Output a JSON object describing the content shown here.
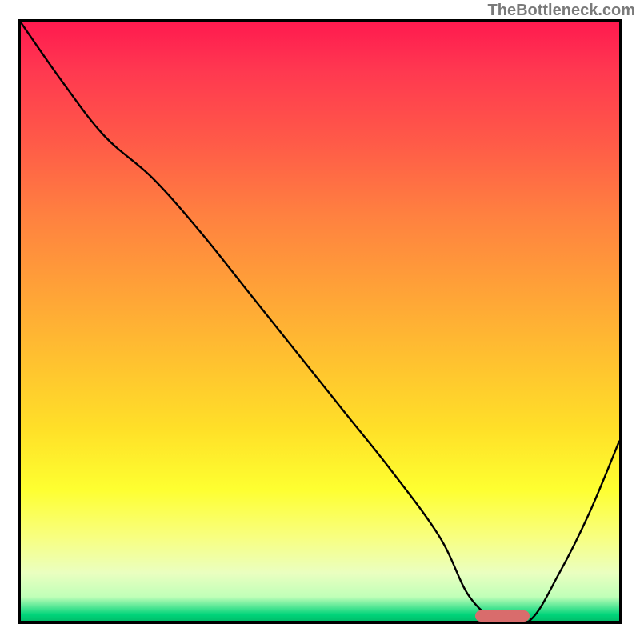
{
  "watermark": "TheBottleneck.com",
  "chart_data": {
    "type": "line",
    "title": "",
    "xlabel": "",
    "ylabel": "",
    "xlim": [
      0,
      100
    ],
    "ylim": [
      0,
      100
    ],
    "series": [
      {
        "name": "bottleneck-curve",
        "x": [
          0,
          7,
          14,
          22,
          30,
          38,
          46,
          54,
          62,
          70,
          75,
          80,
          85,
          90,
          95,
          100
        ],
        "y": [
          100,
          90,
          81,
          74,
          65,
          55,
          45,
          35,
          25,
          14,
          4,
          0,
          0,
          8,
          18,
          30
        ]
      }
    ],
    "marker": {
      "name": "optimal-range",
      "x_start": 76,
      "x_end": 85,
      "y": 0,
      "color": "#d96c6c"
    },
    "legend": null,
    "grid": false
  }
}
